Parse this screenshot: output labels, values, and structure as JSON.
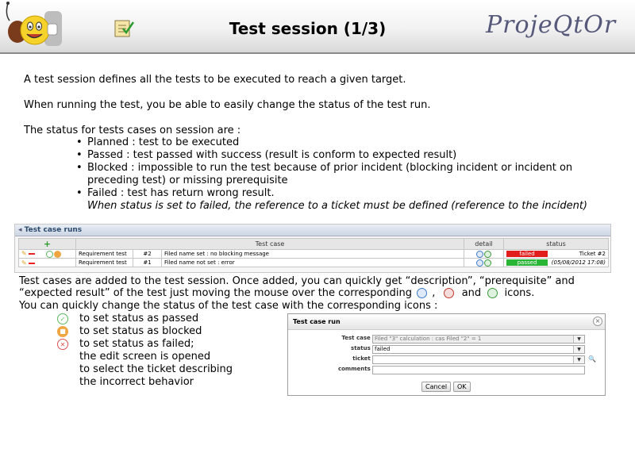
{
  "header": {
    "title": "Test session (1/3)",
    "brand": "ProjeQtOr",
    "logo_icon": "smiley-mascot-icon",
    "page_icon": "checklist-icon"
  },
  "intro": {
    "line1": "A test session defines all the tests to be executed to reach a given target.",
    "line2": "When running the test, you be able to easily change the status of the test run.",
    "line3": "The status for tests cases on session are :"
  },
  "bullets": [
    {
      "text": "Planned : test to be executed",
      "cont": ""
    },
    {
      "text": "Passed : test passed with success (result is conform to expected result)",
      "cont": ""
    },
    {
      "text": "Blocked : impossible to run the test because of prior incident (blocking incident or incident on",
      "cont": "preceding test) or missing prerequisite"
    },
    {
      "text": "Failed : test has return wrong result.",
      "cont": ""
    }
  ],
  "failed_note": "When status is set to failed, the reference to a ticket must be defined (reference to the incident)",
  "panel": {
    "title": "Test case runs",
    "columns": {
      "add": "+",
      "testcase": "Test case",
      "detail": "detail",
      "status": "status"
    },
    "rows": [
      {
        "type": "Requirement test",
        "id": "#2",
        "name": "Filed name set : no blocking message",
        "status": "failed",
        "ticket": "Ticket #2"
      },
      {
        "type": "Requirement test",
        "id": "#1",
        "name": "Filed name not set : error",
        "status": "passed",
        "ticket": "(05/08/2012 17:08)"
      }
    ],
    "colors": {
      "failed": "#e21d1d",
      "passed": "#29b536"
    }
  },
  "body": {
    "added1": "Test cases are added to the test session. Once added, you can quickly get “description”, “prerequisite” and",
    "added2a": "“expected result” of the test just moving the mouse over the corresponding",
    "added2b": ",",
    "added2c": "and",
    "added2d": "icons.",
    "change": "You can quickly change the status of the test case with the corresponding icons :"
  },
  "status_icons": [
    {
      "icon": "passed-icon",
      "label": "to set status as passed",
      "color": "#5cb85c"
    },
    {
      "icon": "blocked-icon",
      "label": "to set status as blocked",
      "color": "#f0a640"
    },
    {
      "icon": "failed-icon",
      "label": "to set status as failed;",
      "color": "#e05050"
    },
    {
      "icon": "",
      "label": "the edit screen is opened",
      "color": ""
    },
    {
      "icon": "",
      "label": "to select the ticket describing",
      "color": ""
    },
    {
      "icon": "",
      "label": "the incorrect behavior",
      "color": ""
    }
  ],
  "dialog": {
    "title": "Test case run",
    "testcase_label": "Test case :",
    "testcase_value": "Filed \"3\" calculation : cas Filed \"2\" = 1",
    "status_label": "status :",
    "status_value": "failed",
    "ticket_label": "ticket :",
    "ticket_value": "",
    "comments_label": "comments :",
    "comments_value": "",
    "cancel": "Cancel",
    "ok": "OK"
  }
}
